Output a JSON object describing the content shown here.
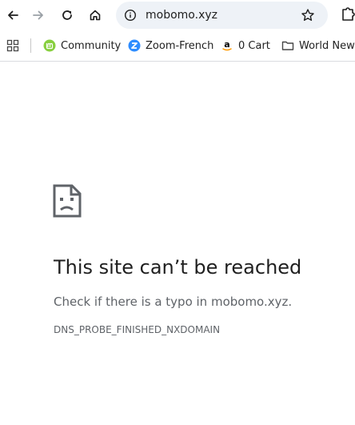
{
  "toolbar": {
    "back_icon": "arrow-left-icon",
    "forward_icon": "arrow-right-icon",
    "reload_icon": "reload-icon",
    "home_icon": "home-icon",
    "url": "mobomo.xyz",
    "info_icon": "info-icon",
    "bookmark_icon": "star-icon",
    "extensions_icon": "puzzle-icon"
  },
  "bookmarks": {
    "apps_icon": "apps-grid-icon",
    "items": [
      {
        "label": "Community",
        "icon": "linux-mint-icon",
        "color": "#87cf3e"
      },
      {
        "label": "Zoom-French",
        "icon": "zoom-icon",
        "color": "#2d8cff"
      },
      {
        "label": "0 Cart",
        "icon": "amazon-icon",
        "color": "#ff9900"
      },
      {
        "label": "World News",
        "icon": "folder-icon",
        "color": "#474747"
      }
    ]
  },
  "error": {
    "icon": "sad-page-icon",
    "title": "This site can’t be reached",
    "description": "Check if there is a typo in mobomo.xyz.",
    "code": "DNS_PROBE_FINISHED_NXDOMAIN"
  }
}
